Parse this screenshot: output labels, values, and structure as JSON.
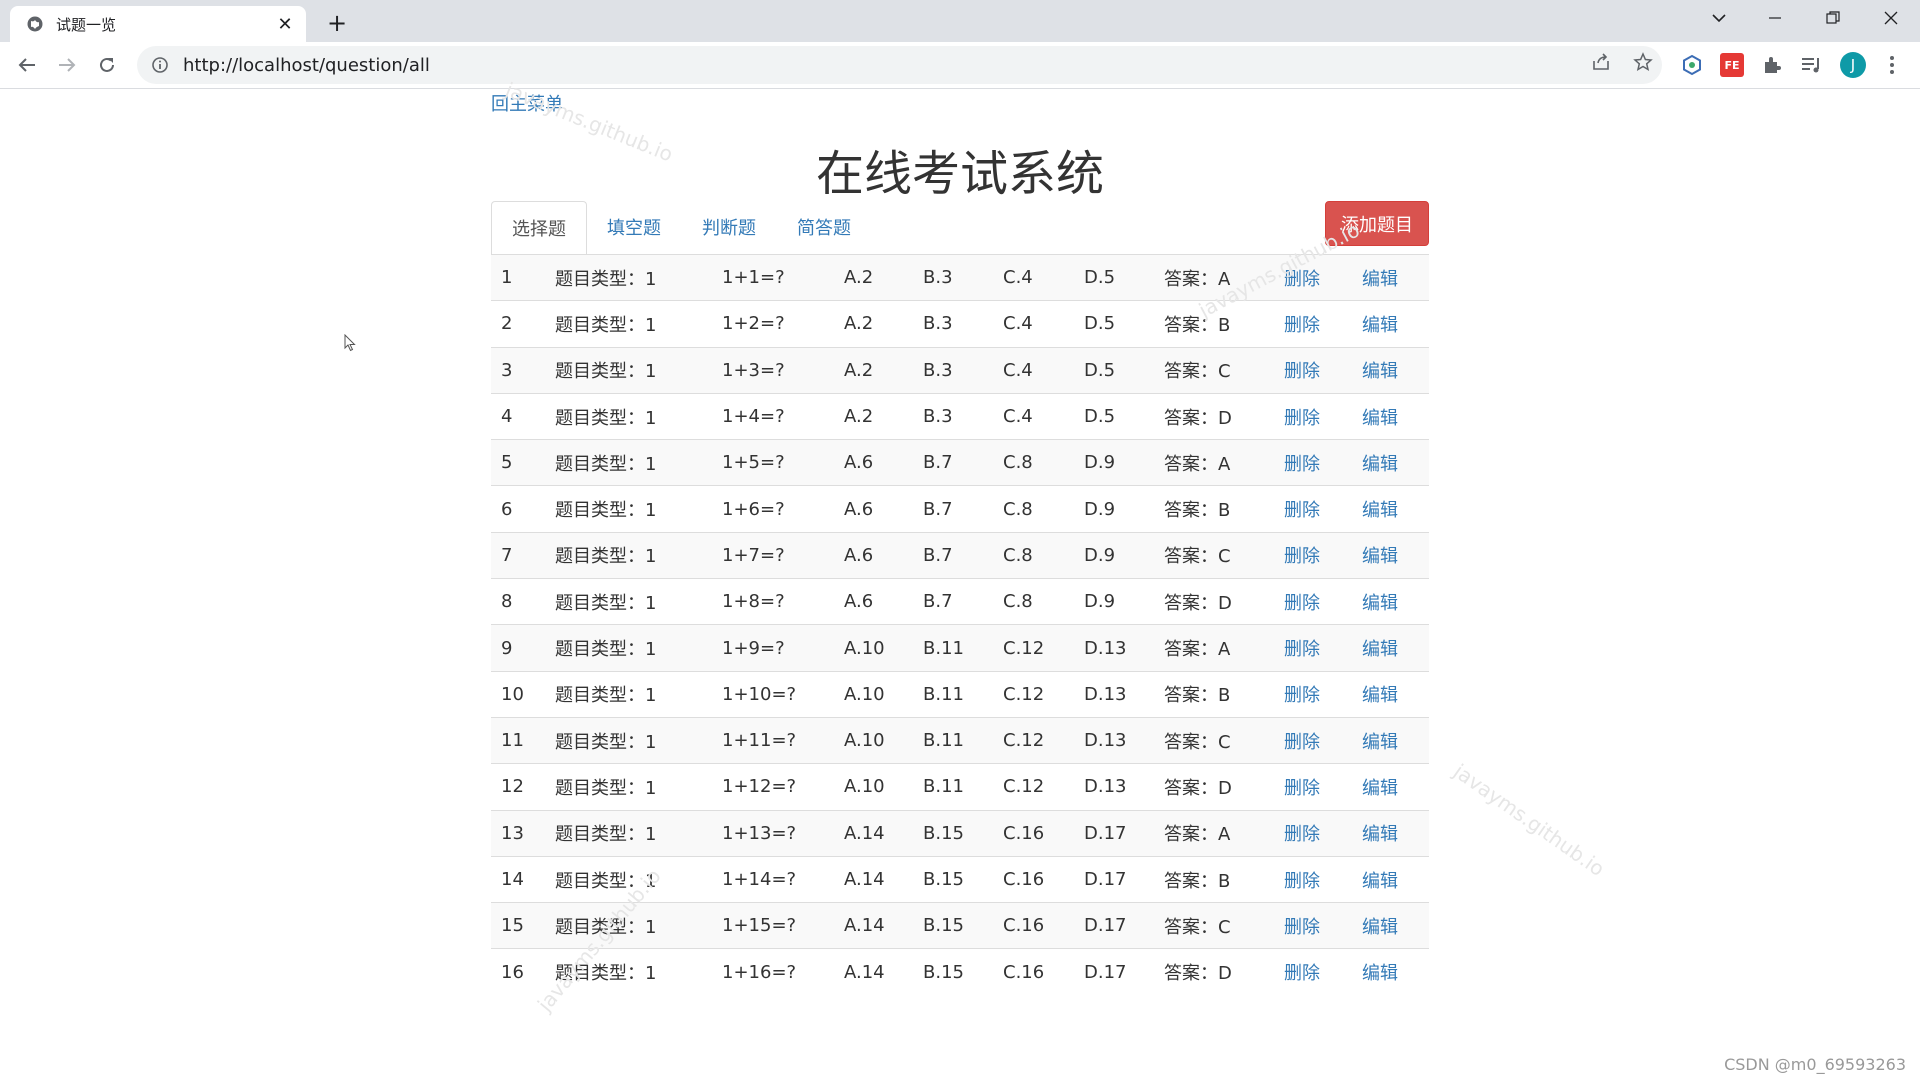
{
  "browser": {
    "tab_title": "试题一览",
    "tab_close": "✕",
    "new_tab": "+",
    "url": "http://localhost/question/all",
    "profile_initial": "J",
    "ext_fe_label": "FE"
  },
  "page": {
    "back_link": "回主菜单",
    "title": "在线考试系统",
    "tabs": [
      "选择题",
      "填空题",
      "判断题",
      "简答题"
    ],
    "active_tab": "选择题",
    "add_button": "添加题目",
    "delete_label": "删除",
    "edit_label": "编辑",
    "watermark": "javayms.github.io",
    "footer_credit": "CSDN @m0_69593263"
  },
  "questions": [
    {
      "id": "1",
      "type": "题目类型：1",
      "q": "1+1=?",
      "a": "A.2",
      "b": "B.3",
      "c": "C.4",
      "d": "D.5",
      "ans": "答案：A"
    },
    {
      "id": "2",
      "type": "题目类型：1",
      "q": "1+2=?",
      "a": "A.2",
      "b": "B.3",
      "c": "C.4",
      "d": "D.5",
      "ans": "答案：B"
    },
    {
      "id": "3",
      "type": "题目类型：1",
      "q": "1+3=?",
      "a": "A.2",
      "b": "B.3",
      "c": "C.4",
      "d": "D.5",
      "ans": "答案：C"
    },
    {
      "id": "4",
      "type": "题目类型：1",
      "q": "1+4=?",
      "a": "A.2",
      "b": "B.3",
      "c": "C.4",
      "d": "D.5",
      "ans": "答案：D"
    },
    {
      "id": "5",
      "type": "题目类型：1",
      "q": "1+5=?",
      "a": "A.6",
      "b": "B.7",
      "c": "C.8",
      "d": "D.9",
      "ans": "答案：A"
    },
    {
      "id": "6",
      "type": "题目类型：1",
      "q": "1+6=?",
      "a": "A.6",
      "b": "B.7",
      "c": "C.8",
      "d": "D.9",
      "ans": "答案：B"
    },
    {
      "id": "7",
      "type": "题目类型：1",
      "q": "1+7=?",
      "a": "A.6",
      "b": "B.7",
      "c": "C.8",
      "d": "D.9",
      "ans": "答案：C"
    },
    {
      "id": "8",
      "type": "题目类型：1",
      "q": "1+8=?",
      "a": "A.6",
      "b": "B.7",
      "c": "C.8",
      "d": "D.9",
      "ans": "答案：D"
    },
    {
      "id": "9",
      "type": "题目类型：1",
      "q": "1+9=?",
      "a": "A.10",
      "b": "B.11",
      "c": "C.12",
      "d": "D.13",
      "ans": "答案：A"
    },
    {
      "id": "10",
      "type": "题目类型：1",
      "q": "1+10=?",
      "a": "A.10",
      "b": "B.11",
      "c": "C.12",
      "d": "D.13",
      "ans": "答案：B"
    },
    {
      "id": "11",
      "type": "题目类型：1",
      "q": "1+11=?",
      "a": "A.10",
      "b": "B.11",
      "c": "C.12",
      "d": "D.13",
      "ans": "答案：C"
    },
    {
      "id": "12",
      "type": "题目类型：1",
      "q": "1+12=?",
      "a": "A.10",
      "b": "B.11",
      "c": "C.12",
      "d": "D.13",
      "ans": "答案：D"
    },
    {
      "id": "13",
      "type": "题目类型：1",
      "q": "1+13=?",
      "a": "A.14",
      "b": "B.15",
      "c": "C.16",
      "d": "D.17",
      "ans": "答案：A"
    },
    {
      "id": "14",
      "type": "题目类型：1",
      "q": "1+14=?",
      "a": "A.14",
      "b": "B.15",
      "c": "C.16",
      "d": "D.17",
      "ans": "答案：B"
    },
    {
      "id": "15",
      "type": "题目类型：1",
      "q": "1+15=?",
      "a": "A.14",
      "b": "B.15",
      "c": "C.16",
      "d": "D.17",
      "ans": "答案：C"
    },
    {
      "id": "16",
      "type": "题目类型：1",
      "q": "1+16=?",
      "a": "A.14",
      "b": "B.15",
      "c": "C.16",
      "d": "D.17",
      "ans": "答案：D"
    }
  ],
  "colors": {
    "link": "#337ab7",
    "danger": "#d9534f",
    "tabbar": "#dee1e6",
    "profile": "#0e9aa7"
  }
}
